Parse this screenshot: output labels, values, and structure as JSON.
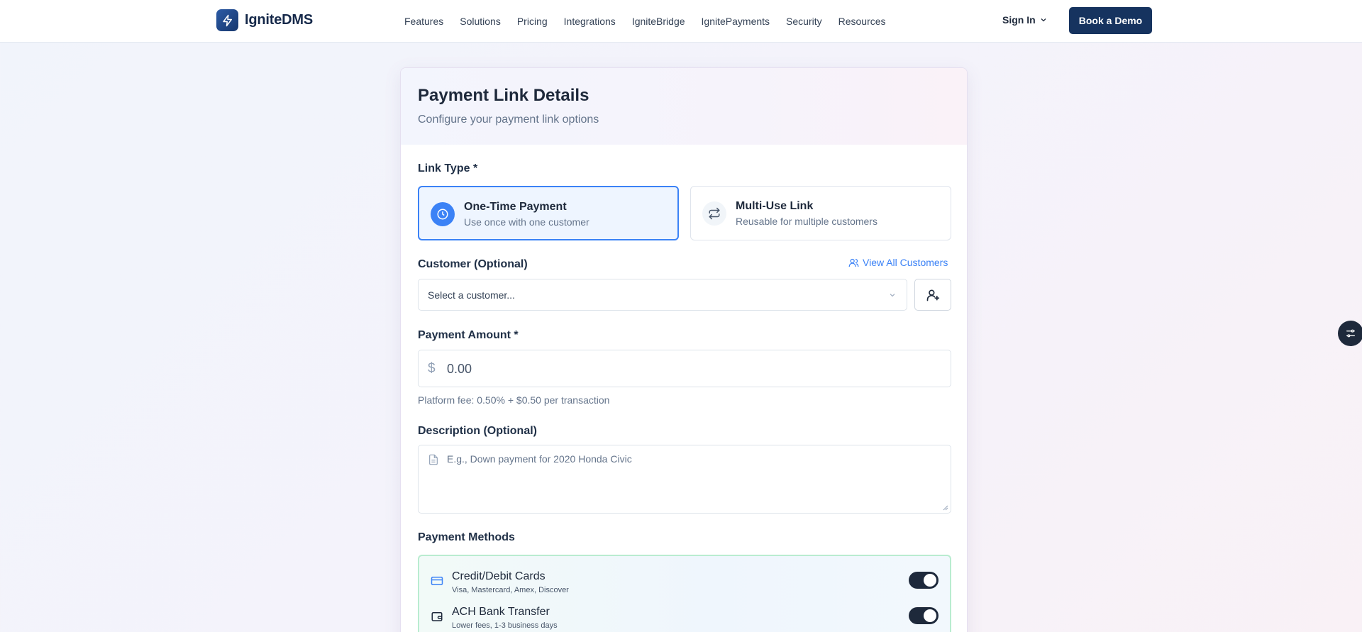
{
  "brand": {
    "name": "IgniteDMS",
    "logo_icon": "lightning-icon"
  },
  "nav": {
    "items": [
      "Features",
      "Solutions",
      "Pricing",
      "Integrations",
      "IgniteBridge",
      "IgnitePayments",
      "Security",
      "Resources"
    ],
    "sign_in": "Sign In",
    "book_demo": "Book a Demo"
  },
  "card": {
    "title": "Payment Link Details",
    "subtitle": "Configure your payment link options"
  },
  "link_type": {
    "label": "Link Type *",
    "options": [
      {
        "title": "One-Time Payment",
        "desc": "Use once with one customer",
        "icon": "clock-icon",
        "selected": true
      },
      {
        "title": "Multi-Use Link",
        "desc": "Reusable for multiple customers",
        "icon": "repeat-icon",
        "selected": false
      }
    ]
  },
  "customer": {
    "label": "Customer (Optional)",
    "view_all": "View All Customers",
    "select_value": "Select a customer...",
    "add_icon": "add-user-icon"
  },
  "amount": {
    "label": "Payment Amount *",
    "currency": "$",
    "placeholder": "0.00",
    "fee_note": "Platform fee: 0.50% + $0.50 per transaction"
  },
  "description": {
    "label": "Description (Optional)",
    "placeholder": "E.g., Down payment for 2020 Honda Civic"
  },
  "methods": {
    "label": "Payment Methods",
    "items": [
      {
        "title": "Credit/Debit Cards",
        "sub": "Visa, Mastercard, Amex, Discover",
        "icon": "credit-card-icon",
        "enabled": true
      },
      {
        "title": "ACH Bank Transfer",
        "sub": "Lower fees, 1-3 business days",
        "icon": "wallet-icon",
        "enabled": true
      }
    ]
  },
  "colors": {
    "primary": "#16335f",
    "accent": "#3b82f6",
    "selected_bg": "#eef5ff",
    "methods_border": "#b9ecd0"
  }
}
